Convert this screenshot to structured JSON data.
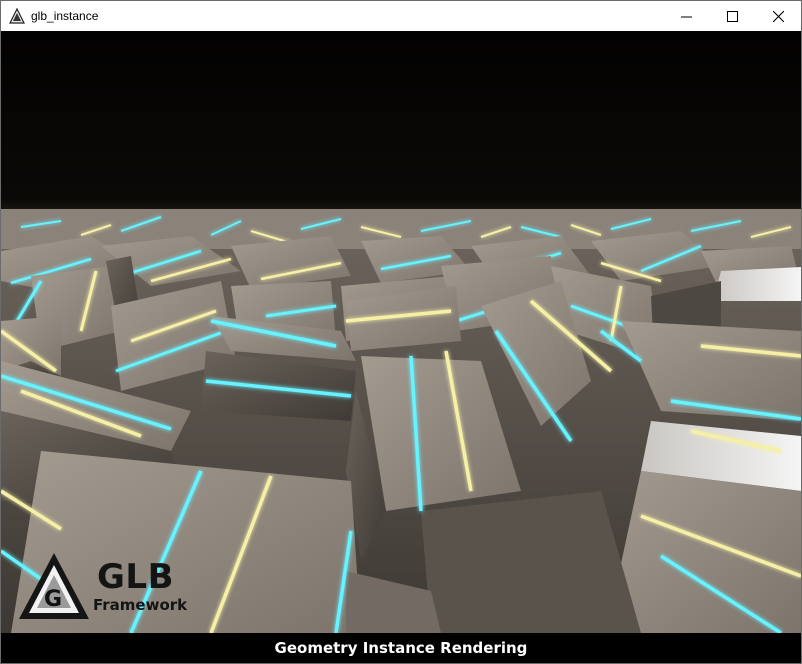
{
  "window": {
    "title": "glb_instance",
    "app_icon": "glb-logo-icon",
    "controls": [
      "minimize-icon",
      "maximize-icon",
      "close-icon"
    ]
  },
  "viewport": {
    "scene": "instanced boxes with glowing cyan and pale-yellow light strips",
    "colors": {
      "sky": "#050403",
      "box_face": "#8e857c",
      "box_side": "#5f5852",
      "glow_cyan": "#66f2ff",
      "glow_yellow": "#f6f0a6"
    }
  },
  "logo": {
    "mark_letter": "G",
    "name": "GLB",
    "subtitle": "Framework"
  },
  "caption": "Geometry Instance Rendering"
}
